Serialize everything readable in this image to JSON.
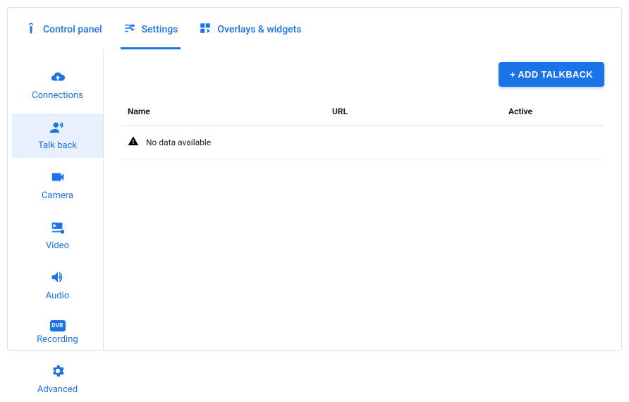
{
  "tabs": {
    "control_panel": "Control panel",
    "settings": "Settings",
    "overlays": "Overlays & widgets",
    "active": "settings"
  },
  "sidebar": {
    "items": [
      {
        "id": "connections",
        "label": "Connections"
      },
      {
        "id": "talkback",
        "label": "Talk back"
      },
      {
        "id": "camera",
        "label": "Camera"
      },
      {
        "id": "video",
        "label": "Video"
      },
      {
        "id": "audio",
        "label": "Audio"
      },
      {
        "id": "recording",
        "label": "Recording",
        "badge": "DVR"
      },
      {
        "id": "advanced",
        "label": "Advanced"
      }
    ],
    "active": "talkback"
  },
  "content": {
    "add_button": "+ ADD TALKBACK",
    "columns": {
      "name": "Name",
      "url": "URL",
      "active": "Active"
    },
    "empty_message": "No data available"
  }
}
